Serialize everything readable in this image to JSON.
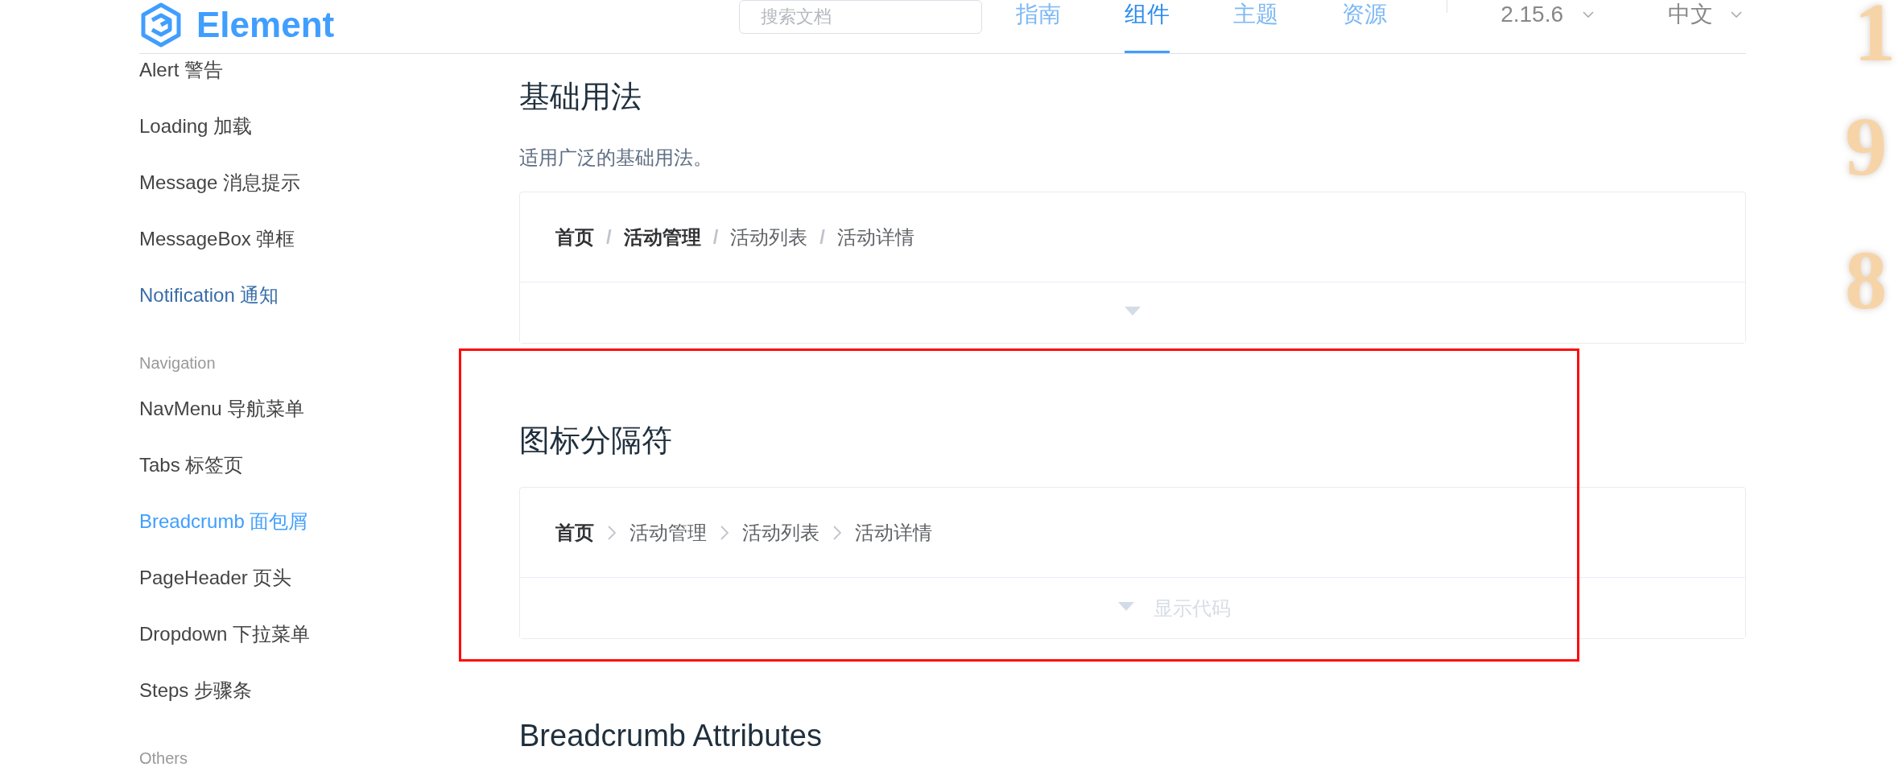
{
  "header": {
    "logo": "Element",
    "search": {
      "placeholder": "搜索文档"
    },
    "nav": [
      {
        "label": "指南",
        "selected": false
      },
      {
        "label": "组件",
        "selected": true
      },
      {
        "label": "主题",
        "selected": false
      },
      {
        "label": "资源",
        "selected": false
      }
    ],
    "version": "2.15.6",
    "language": "中文"
  },
  "sidebar": {
    "entries": [
      {
        "kind": "link",
        "label": "Alert 警告",
        "selected": false,
        "hovered": false
      },
      {
        "kind": "link",
        "label": "Loading 加载",
        "selected": false,
        "hovered": false
      },
      {
        "kind": "link",
        "label": "Message 消息提示",
        "selected": false,
        "hovered": false
      },
      {
        "kind": "link",
        "label": "MessageBox 弹框",
        "selected": false,
        "hovered": false
      },
      {
        "kind": "link",
        "label": "Notification 通知",
        "selected": false,
        "hovered": true
      },
      {
        "kind": "group",
        "label": "Navigation"
      },
      {
        "kind": "link",
        "label": "NavMenu 导航菜单",
        "selected": false,
        "hovered": false
      },
      {
        "kind": "link",
        "label": "Tabs 标签页",
        "selected": false,
        "hovered": false
      },
      {
        "kind": "link",
        "label": "Breadcrumb 面包屑",
        "selected": true,
        "hovered": false
      },
      {
        "kind": "link",
        "label": "PageHeader 页头",
        "selected": false,
        "hovered": false
      },
      {
        "kind": "link",
        "label": "Dropdown 下拉菜单",
        "selected": false,
        "hovered": false
      },
      {
        "kind": "link",
        "label": "Steps 步骤条",
        "selected": false,
        "hovered": false
      },
      {
        "kind": "group",
        "label": "Others"
      }
    ]
  },
  "sections": [
    {
      "title": "基础用法",
      "description": "适用广泛的基础用法。",
      "demo": {
        "items": [
          {
            "kind": "crumb",
            "label": "首页",
            "link": true
          },
          {
            "kind": "separator",
            "text": "/"
          },
          {
            "kind": "crumb",
            "label": "活动管理",
            "link": true
          },
          {
            "kind": "separator",
            "text": "/"
          },
          {
            "kind": "crumb",
            "label": "活动列表",
            "link": false
          },
          {
            "kind": "separator",
            "text": "/"
          },
          {
            "kind": "crumb",
            "label": "活动详情",
            "link": false
          }
        ],
        "control": {
          "hovered": false
        }
      }
    },
    {
      "title": "图标分隔符",
      "demo": {
        "items": [
          {
            "kind": "crumb",
            "label": "首页",
            "link": true
          },
          {
            "kind": "chevron"
          },
          {
            "kind": "crumb",
            "label": "活动管理",
            "link": false
          },
          {
            "kind": "chevron"
          },
          {
            "kind": "crumb",
            "label": "活动列表",
            "link": false
          },
          {
            "kind": "chevron"
          },
          {
            "kind": "crumb",
            "label": "活动详情",
            "link": false
          }
        ],
        "control": {
          "hovered": true,
          "label": "显示代码"
        }
      }
    },
    {
      "title": "Breadcrumb Attributes"
    }
  ],
  "highlight_frame": true,
  "edge_numbers": [
    "1",
    "9",
    "8"
  ]
}
